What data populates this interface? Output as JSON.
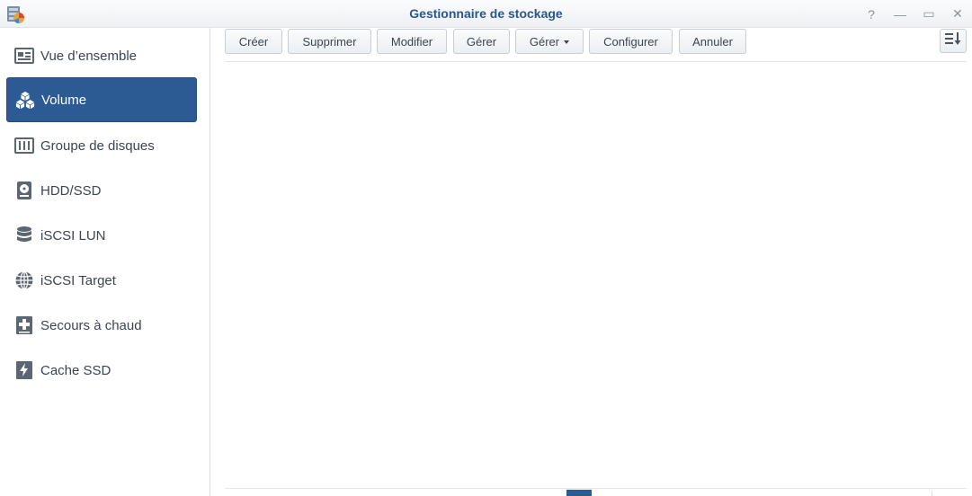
{
  "window": {
    "title": "Gestionnaire de stockage",
    "controls": [
      {
        "icon": "help-icon",
        "glyph": "?"
      },
      {
        "icon": "minimize-icon",
        "glyph": "—"
      },
      {
        "icon": "maximize-icon",
        "glyph": "▭"
      },
      {
        "icon": "close-icon",
        "glyph": "✕"
      }
    ]
  },
  "sidebar": {
    "items": [
      {
        "label": "Vue d’ensemble",
        "icon": "overview-icon",
        "active": false
      },
      {
        "label": "Volume",
        "icon": "volume-icon",
        "active": true
      },
      {
        "label": "Groupe de disques",
        "icon": "disk-group-icon",
        "active": false
      },
      {
        "label": "HDD/SSD",
        "icon": "hdd-icon",
        "active": false
      },
      {
        "label": "iSCSI LUN",
        "icon": "iscsi-lun-icon",
        "active": false
      },
      {
        "label": "iSCSI Target",
        "icon": "iscsi-target-icon",
        "active": false
      },
      {
        "label": "Secours à chaud",
        "icon": "hot-spare-icon",
        "active": false
      },
      {
        "label": "Cache SSD",
        "icon": "ssd-cache-icon",
        "active": false
      }
    ]
  },
  "toolbar": {
    "buttons": [
      {
        "label": "Créer"
      },
      {
        "label": "Supprimer"
      },
      {
        "label": "Modifier"
      },
      {
        "label": "Gérer"
      },
      {
        "label": "Gérer",
        "dropdown": true
      },
      {
        "label": "Configurer"
      },
      {
        "label": "Annuler"
      }
    ],
    "sort_icon": "sort-icon"
  },
  "colors": {
    "accent": "#2b5b92",
    "title": "#29578d"
  }
}
